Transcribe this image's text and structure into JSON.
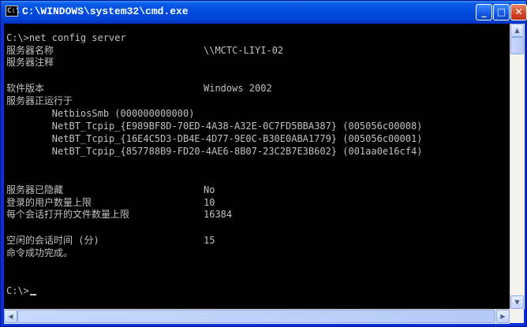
{
  "window": {
    "title": "C:\\WINDOWS\\system32\\cmd.exe",
    "icon_text": "C:\\",
    "buttons": {
      "minimize": "_",
      "maximize": "□",
      "close": "✕"
    }
  },
  "console": {
    "lines": [
      {
        "label": "C:\\>net config server",
        "value": ""
      },
      {
        "label": "服务器名称",
        "value": "\\\\MCTC-LIYI-02"
      },
      {
        "label": "服务器注释",
        "value": ""
      },
      {
        "label": "",
        "value": ""
      },
      {
        "label": "软件版本",
        "value": "Windows 2002"
      },
      {
        "label": "服务器正运行于",
        "value": ""
      },
      {
        "label": "        NetbiosSmb (000000000000)",
        "value": ""
      },
      {
        "label": "        NetBT_Tcpip_{E989BF8D-70ED-4A38-A32E-0C7FD5BBA387} (005056c00008)",
        "value": ""
      },
      {
        "label": "        NetBT_Tcpip_{16E4C5D3-DB4E-4D77-9E0C-B30E0ABA1779} (005056c00001)",
        "value": ""
      },
      {
        "label": "        NetBT_Tcpip_{857788B9-FD20-4AE6-8B07-23C2B7E3B602} (001aa0e16cf4)",
        "value": ""
      },
      {
        "label": "",
        "value": ""
      },
      {
        "label": "",
        "value": ""
      },
      {
        "label": "",
        "value": ""
      },
      {
        "label": "服务器已隐藏",
        "value": "No"
      },
      {
        "label": "登录的用户数量上限",
        "value": "10"
      },
      {
        "label": "每个会话打开的文件数量上限",
        "value": "16384"
      },
      {
        "label": "",
        "value": ""
      },
      {
        "label": "空闲的会话时间 (分)",
        "value": "15"
      },
      {
        "label": "命令成功完成。",
        "value": ""
      },
      {
        "label": "",
        "value": ""
      },
      {
        "label": "",
        "value": ""
      },
      {
        "label": "",
        "value": ""
      },
      {
        "label": "C:\\>",
        "value": ""
      }
    ]
  },
  "scrollbars": {
    "up_arrow": "▲",
    "down_arrow": "▼",
    "left_arrow": "◀",
    "right_arrow": "▶"
  },
  "colors": {
    "console_bg": "#000000",
    "console_text": "#c0c0c0",
    "titlebar": "#0a5ce5"
  }
}
